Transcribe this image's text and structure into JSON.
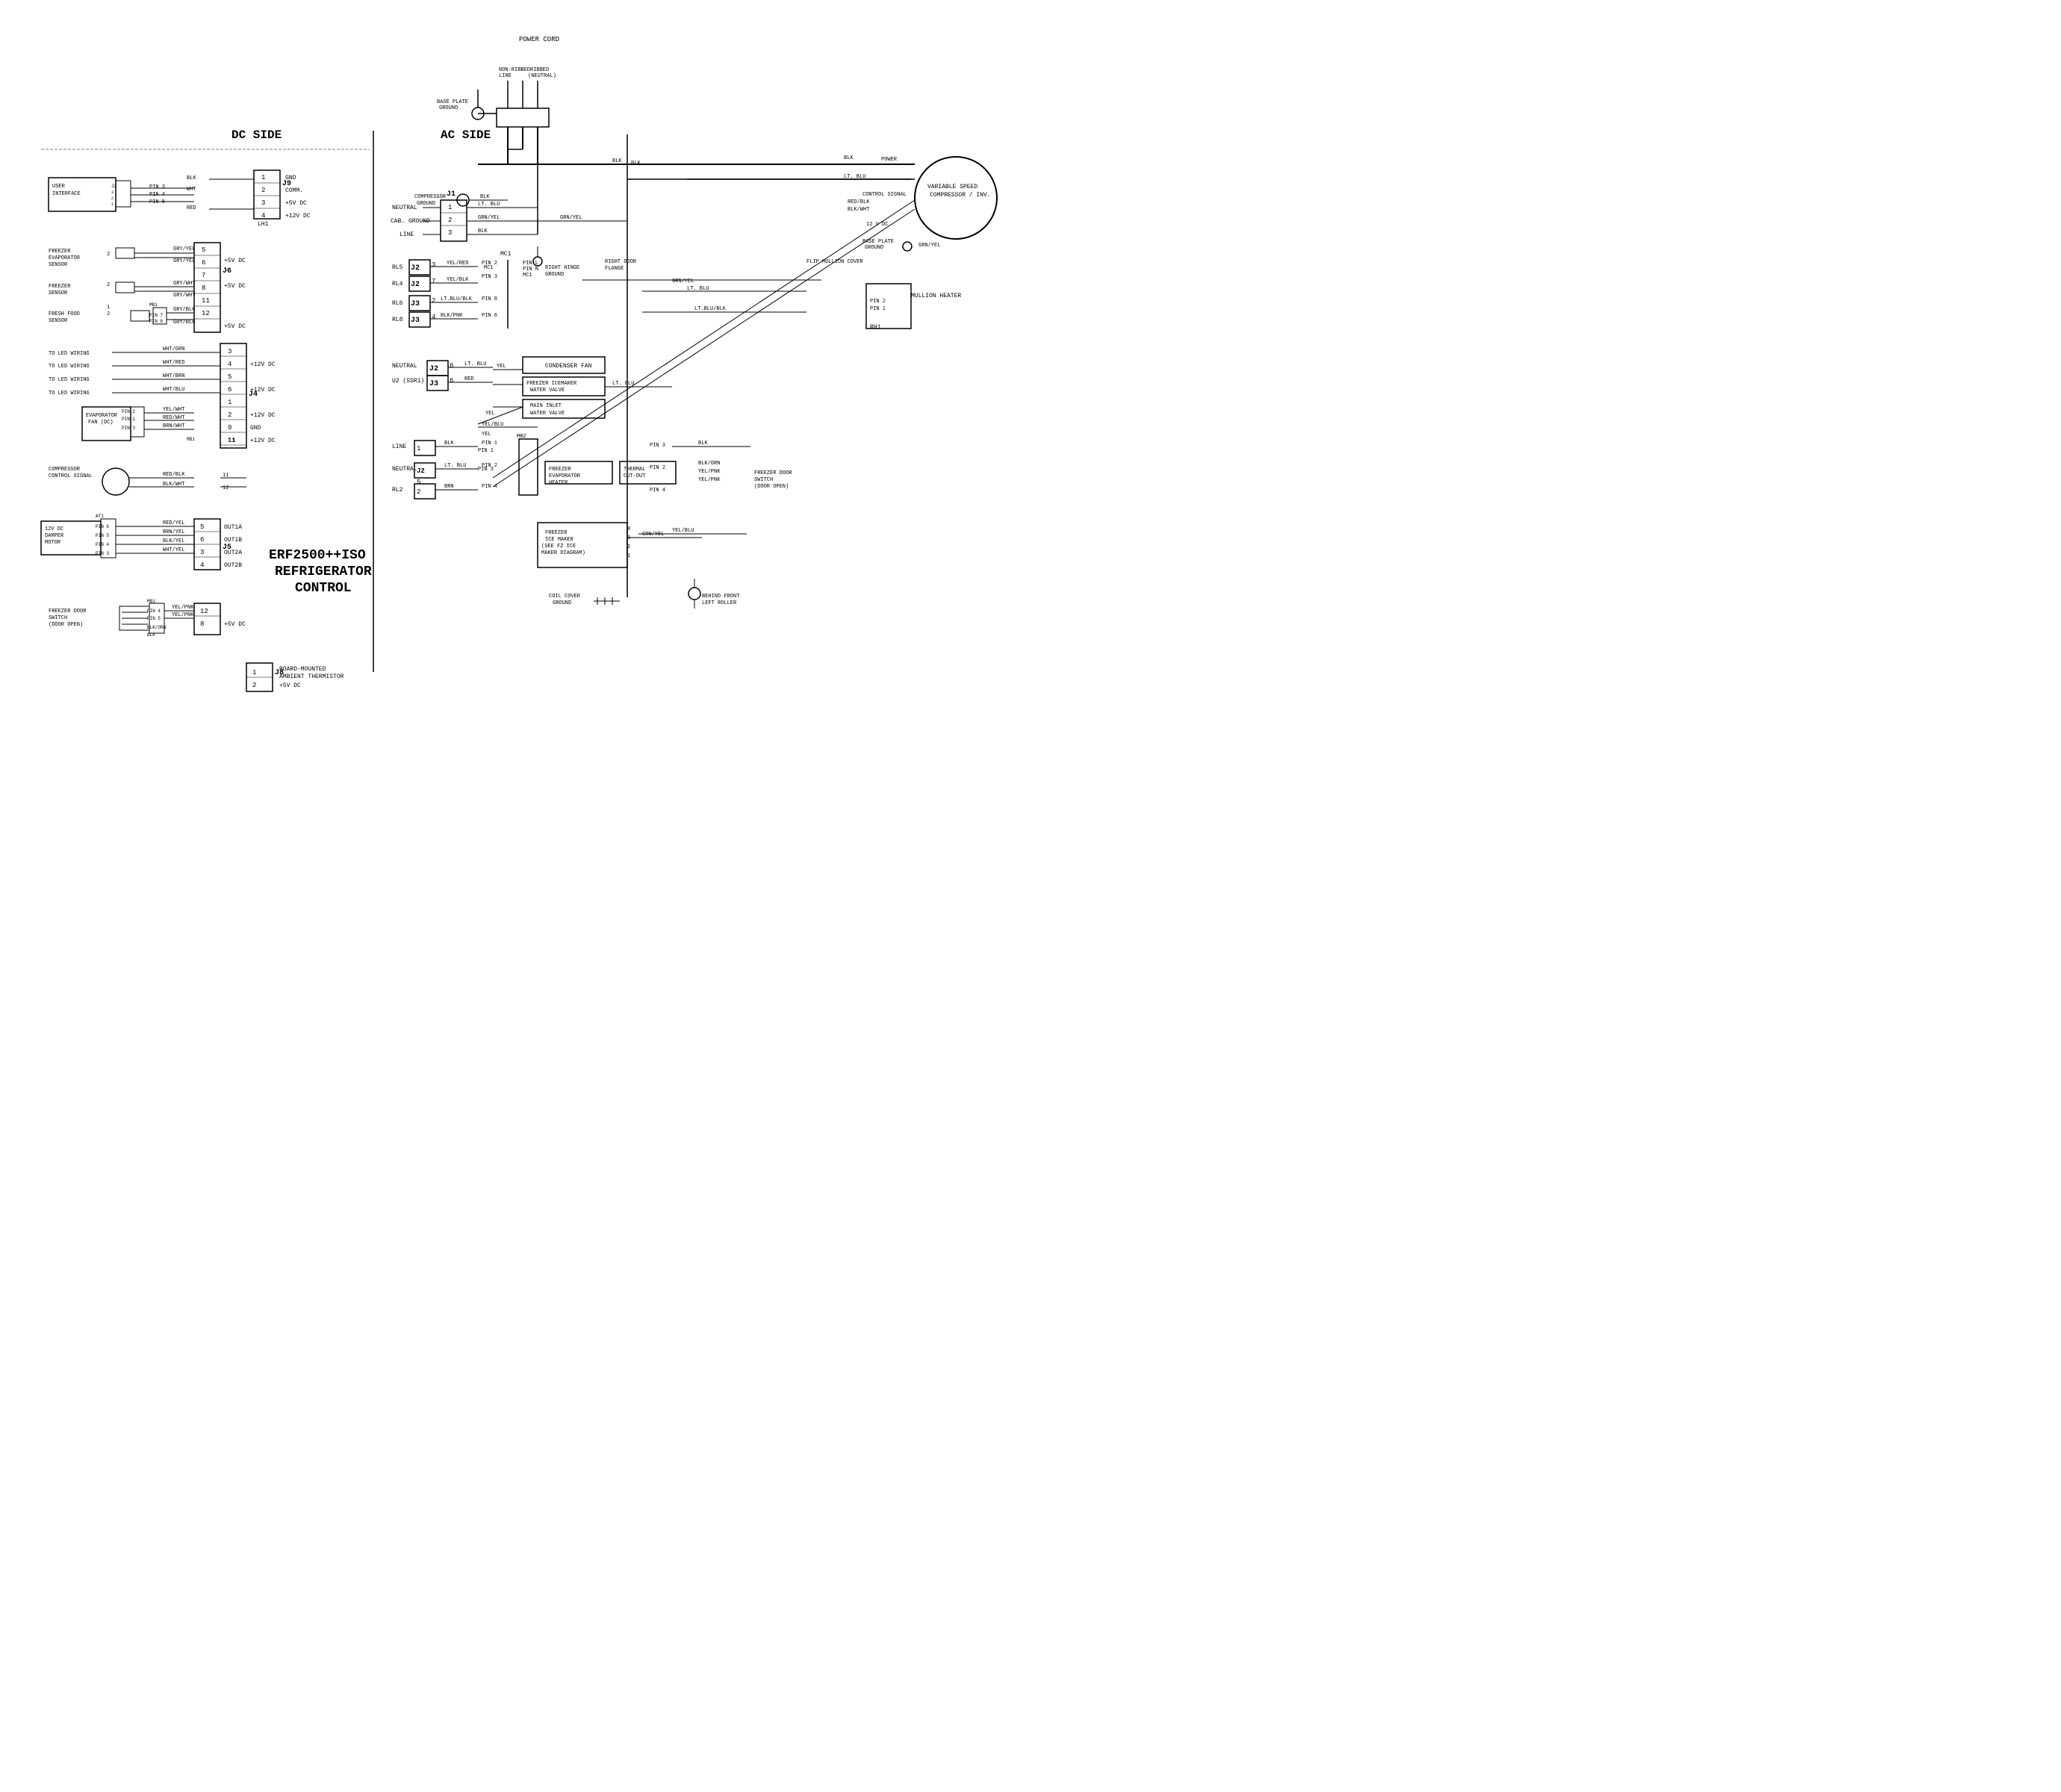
{
  "title": "ERF2500++ISO REFRIGERATOR CONTROL",
  "diagram": {
    "dc_side_label": "DC SIDE",
    "ac_side_label": "AC SIDE",
    "power_cord_label": "POWER CORD",
    "title_line1": "ERF2500++ISO",
    "title_line2": "REFRIGERATOR",
    "title_line3": "CONTROL",
    "variable_speed_compressor": "VARIABLE SPEED COMPRESSOR / INV.",
    "user_interface": "USER INTERFACE"
  }
}
